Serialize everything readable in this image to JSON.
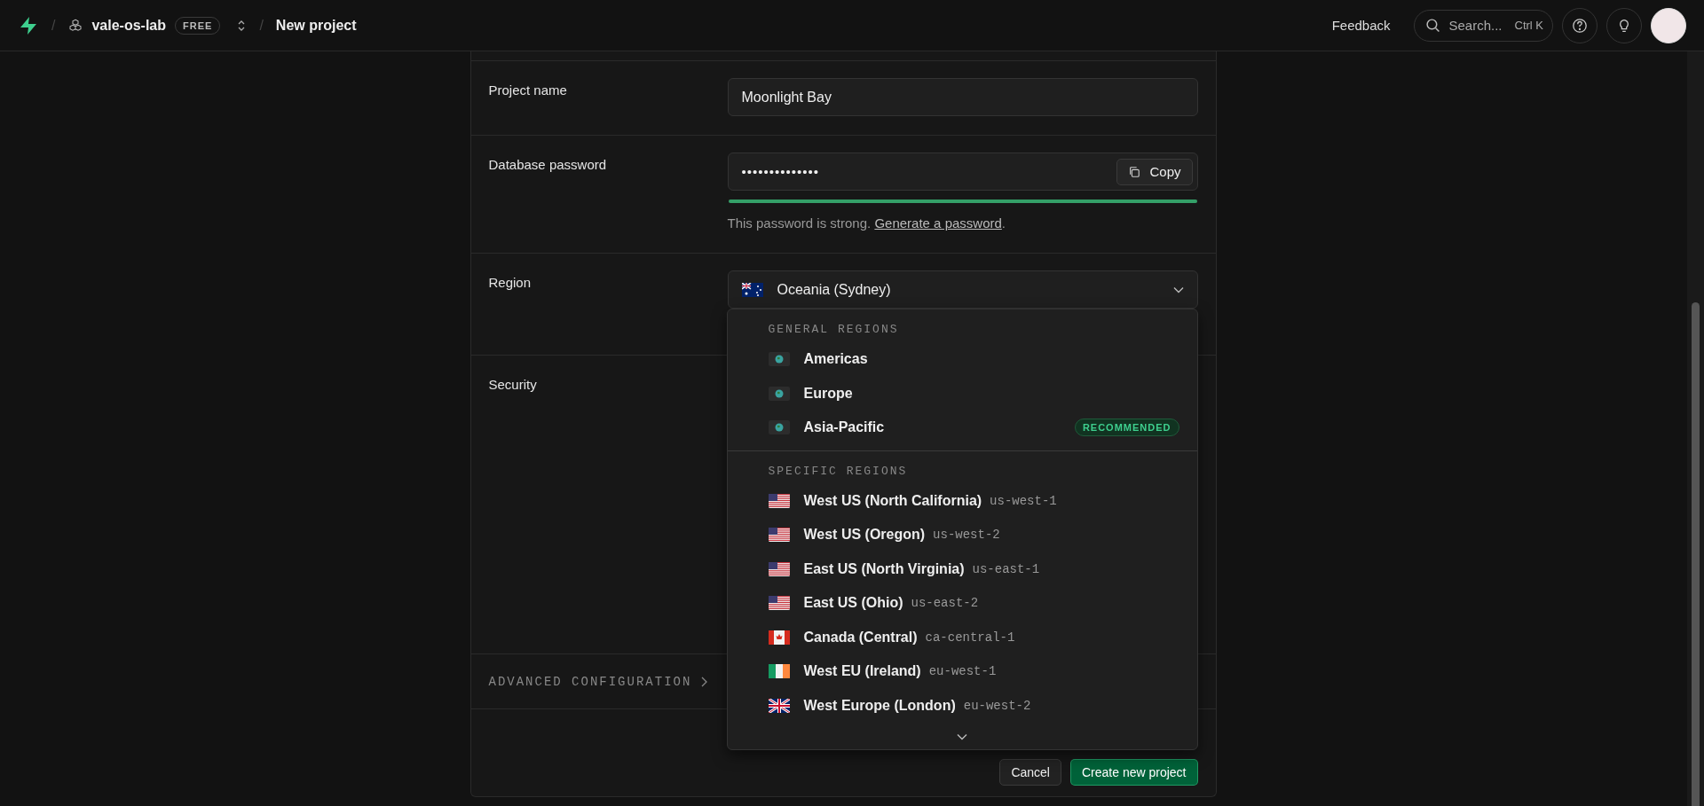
{
  "topbar": {
    "separators": [
      "/",
      "/"
    ],
    "org": "vale-os-lab",
    "plan_badge": "FREE",
    "page": "New project",
    "feedback": "Feedback",
    "search": {
      "placeholder": "Search...",
      "shortcut": "Ctrl K"
    }
  },
  "form": {
    "fields": [
      {
        "kind": "text",
        "label": "Project name",
        "value": "Moonlight Bay"
      },
      {
        "kind": "password",
        "label": "Database password",
        "value": "••••••••••••••",
        "copy_button": "Copy",
        "strength": {
          "level": 1
        },
        "hint": {
          "text": "This password is strong.",
          "link": "Generate a password",
          "end": "."
        }
      },
      {
        "kind": "select",
        "label": "Region",
        "selected_option": {
          "kind": "au",
          "name": "Oceania (Sydney)"
        }
      },
      {
        "kind": "empty",
        "label": "Security"
      }
    ],
    "advanced": "ADVANCED CONFIGURATION",
    "buttons": [
      {
        "kind": "secondary",
        "label": "Cancel"
      },
      {
        "kind": "primary",
        "label": "Create new project"
      }
    ]
  },
  "region_dropdown": {
    "groups": [
      {
        "heading": "GENERAL REGIONS",
        "options": [
          {
            "kind": "globe",
            "name": "Americas"
          },
          {
            "kind": "globe",
            "name": "Europe"
          },
          {
            "kind": "globe",
            "name": "Asia-Pacific",
            "badge": "RECOMMENDED"
          }
        ]
      },
      {
        "heading": "SPECIFIC REGIONS",
        "options": [
          {
            "kind": "us",
            "name": "West US (North California)",
            "code": "us-west-1"
          },
          {
            "kind": "us",
            "name": "West US (Oregon)",
            "code": "us-west-2"
          },
          {
            "kind": "us",
            "name": "East US (North Virginia)",
            "code": "us-east-1"
          },
          {
            "kind": "us",
            "name": "East US (Ohio)",
            "code": "us-east-2"
          },
          {
            "kind": "ca",
            "name": "Canada (Central)",
            "code": "ca-central-1"
          },
          {
            "kind": "ie",
            "name": "West EU (Ireland)",
            "code": "eu-west-1"
          },
          {
            "kind": "uk",
            "name": "West Europe (London)",
            "code": "eu-west-2"
          }
        ]
      }
    ]
  }
}
